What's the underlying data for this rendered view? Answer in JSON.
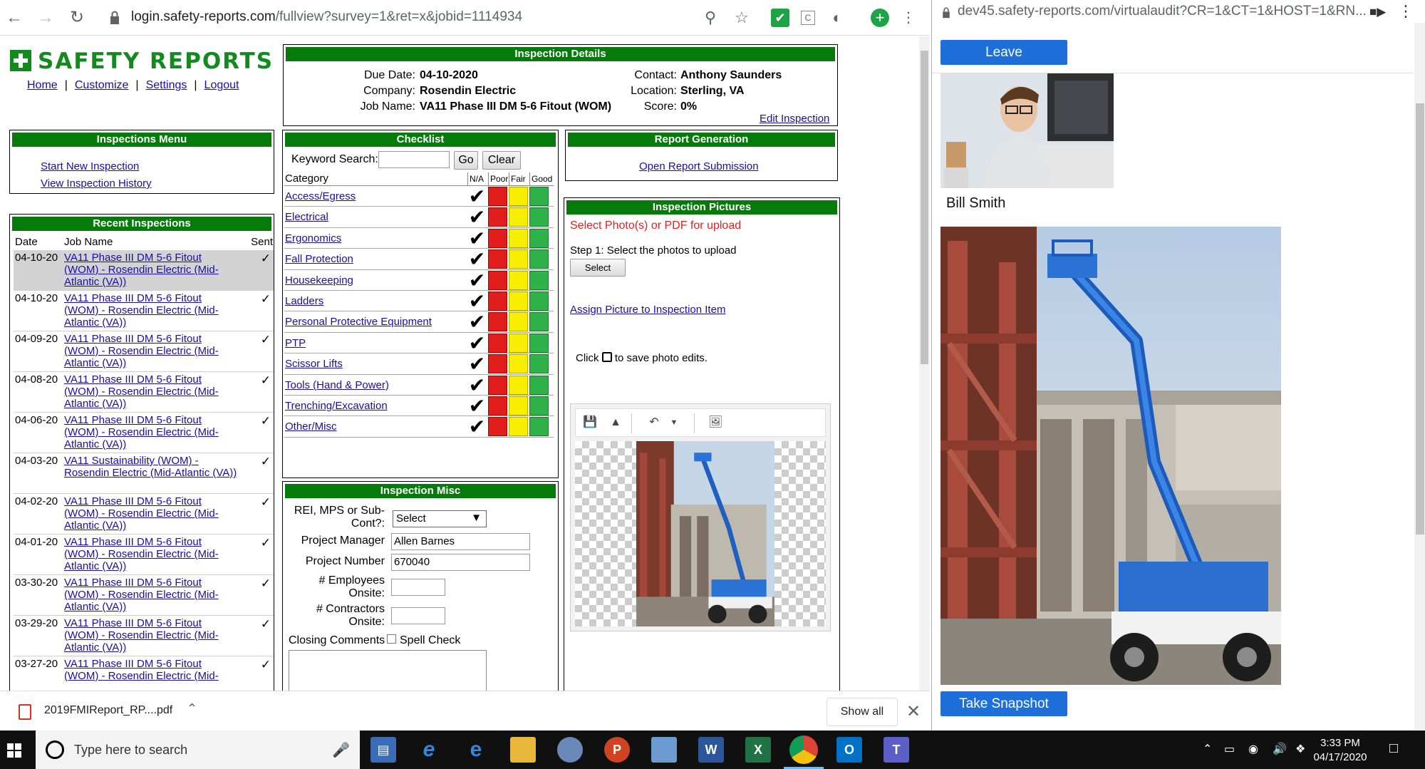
{
  "browser_left": {
    "url": "login.safety-reports.com/fullview?survey=1&ret=x&jobid=1114934",
    "url_host": "login.safety-reports.com",
    "url_path": "/fullview?survey=1&ret=x&jobid=1114934"
  },
  "site": {
    "logo_text": "SAFETY REPORTS",
    "top_links": [
      "Home",
      "Customize",
      "Settings",
      "Logout"
    ]
  },
  "details": {
    "title": "Inspection Details",
    "due_label": "Due Date:",
    "due_value": "04-10-2020",
    "company_label": "Company:",
    "company_value": "Rosendin Electric",
    "job_label": "Job Name:",
    "job_value": "VA11 Phase III DM 5-6 Fitout (WOM)",
    "contact_label": "Contact:",
    "contact_value": "Anthony Saunders",
    "location_label": "Location:",
    "location_value": "Sterling, VA",
    "score_label": "Score:",
    "score_value": "0%",
    "edit_link": "Edit Inspection"
  },
  "menu": {
    "title": "Inspections Menu",
    "start_new": "Start New Inspection",
    "view_history": "View Inspection History"
  },
  "recent": {
    "title": "Recent Inspections",
    "col_date": "Date",
    "col_job": "Job Name",
    "col_sent": "Sent",
    "rows": [
      {
        "date": "04-10-20",
        "job": "VA11 Phase III DM 5-6 Fitout (WOM) - Rosendin Electric (Mid-Atlantic (VA))",
        "sent": "✓"
      },
      {
        "date": "04-10-20",
        "job": "VA11 Phase III DM 5-6 Fitout (WOM) - Rosendin Electric (Mid-Atlantic (VA))",
        "sent": "✓"
      },
      {
        "date": "04-09-20",
        "job": "VA11 Phase III DM 5-6 Fitout (WOM) - Rosendin Electric (Mid-Atlantic (VA))",
        "sent": "✓"
      },
      {
        "date": "04-08-20",
        "job": "VA11 Phase III DM 5-6 Fitout (WOM) - Rosendin Electric (Mid-Atlantic (VA))",
        "sent": "✓"
      },
      {
        "date": "04-06-20",
        "job": "VA11 Phase III DM 5-6 Fitout (WOM) - Rosendin Electric (Mid-Atlantic (VA))",
        "sent": "✓"
      },
      {
        "date": "04-03-20",
        "job": "VA11 Sustainability (WOM) - Rosendin Electric (Mid-Atlantic (VA))",
        "sent": "✓"
      },
      {
        "date": "04-02-20",
        "job": "VA11 Phase III DM 5-6 Fitout (WOM) - Rosendin Electric (Mid-Atlantic (VA))",
        "sent": "✓"
      },
      {
        "date": "04-01-20",
        "job": "VA11 Phase III DM 5-6 Fitout (WOM) - Rosendin Electric (Mid-Atlantic (VA))",
        "sent": "✓"
      },
      {
        "date": "03-30-20",
        "job": "VA11 Phase III DM 5-6 Fitout (WOM) - Rosendin Electric (Mid-Atlantic (VA))",
        "sent": "✓"
      },
      {
        "date": "03-29-20",
        "job": "VA11 Phase III DM 5-6 Fitout (WOM) - Rosendin Electric (Mid-Atlantic (VA))",
        "sent": "✓"
      },
      {
        "date": "03-27-20",
        "job": "VA11 Phase III DM 5-6 Fitout (WOM) - Rosendin Electric (Mid-",
        "sent": "✓"
      }
    ]
  },
  "checklist": {
    "title": "Checklist",
    "keyword_label": "Keyword Search:",
    "go_label": "Go",
    "clear_label": "Clear",
    "col_category": "Category",
    "col_na": "N/A",
    "col_poor": "Poor",
    "col_fair": "Fair",
    "col_good": "Good",
    "categories": [
      "Access/Egress",
      "Electrical",
      "Ergonomics",
      "Fall Protection",
      "Housekeeping",
      "Ladders",
      "Personal Protective Equipment",
      "PTP",
      "Scissor Lifts",
      "Tools (Hand & Power)",
      "Trenching/Excavation",
      "Other/Misc"
    ],
    "selected_rating": "N/A"
  },
  "misc": {
    "title": "Inspection Misc",
    "rei_label": "REI, MPS or Sub-Cont?:",
    "rei_value": "Select",
    "pm_label": "Project Manager",
    "pm_value": "Allen Barnes",
    "pn_label": "Project Number",
    "pn_value": "670040",
    "emp_label": "# Employees Onsite:",
    "con_label": "# Contractors Onsite:",
    "comments_label": "Closing Comments",
    "spell_label": "Spell Check"
  },
  "report": {
    "title": "Report Generation",
    "open_link": "Open Report Submission"
  },
  "pictures": {
    "title": "Inspection Pictures",
    "select_prompt": "Select Photo(s) or PDF for upload",
    "step1": "Step 1: Select the photos to upload",
    "select_btn": "Select",
    "assign_link": "Assign Picture to Inspection Item",
    "click_label": "Click",
    "save_hint": "to save photo edits."
  },
  "download_bar": {
    "file_name": "2019FMIReport_RP....pdf",
    "show_all": "Show all"
  },
  "browser_right": {
    "url": "dev45.safety-reports.com/virtualaudit?CR=1&CT=1&HOST=1&RN..."
  },
  "virtual_audit": {
    "leave_label": "Leave",
    "person_name": "Bill Smith",
    "snapshot_label": "Take Snapshot"
  },
  "taskbar": {
    "search_placeholder": "Type here to search",
    "time": "3:33 PM",
    "date": "04/17/2020"
  },
  "colors": {
    "header_green": "#067a0b",
    "poor": "#e21d1d",
    "fair": "#f7ee00",
    "good": "#2fb24a",
    "link": "#1a0dab",
    "action_blue": "#1e6fd9"
  }
}
